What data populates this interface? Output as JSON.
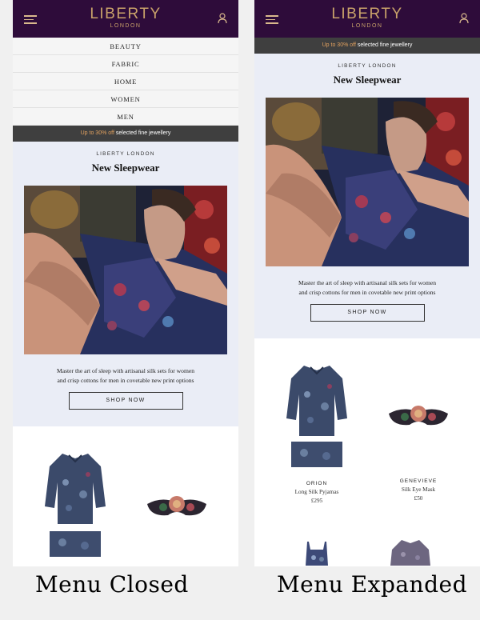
{
  "header": {
    "logo_main": "LIBERTY",
    "logo_sub": "LONDON"
  },
  "menu": {
    "items": [
      "BEAUTY",
      "FABRIC",
      "HOME",
      "WOMEN",
      "MEN"
    ]
  },
  "promo": {
    "highlight": "Up to 30% off",
    "rest": " selected fine jewellery"
  },
  "hero": {
    "brand": "LIBERTY LONDON",
    "headline": "New Sleepwear",
    "description_line1": "Master the art of sleep with artisanal silk sets for women",
    "description_line2": "and crisp cottons for men in covetable new print options",
    "cta_label": "SHOP NOW"
  },
  "products": [
    {
      "name": "ORION",
      "description": "Long Silk Pyjamas",
      "price": "£295"
    },
    {
      "name": "GENEVIEVE",
      "description": "Silk Eye Mask",
      "price": "£50"
    }
  ],
  "captions": {
    "left": "Menu Closed",
    "right": "Menu Expanded"
  },
  "colors": {
    "header_bg": "#2e0c3a",
    "logo_gold": "#c9a26a",
    "promo_bg": "#3f3f3f",
    "promo_highlight": "#e2a15f",
    "hero_bg": "#eaedf6"
  },
  "icons": [
    "hamburger-icon",
    "account-icon"
  ]
}
